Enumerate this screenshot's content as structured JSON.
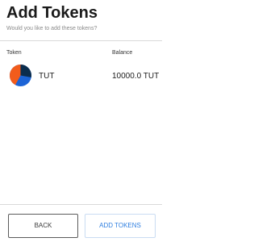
{
  "header": {
    "title": "Add Tokens",
    "subtitle": "Would you like to add these tokens?"
  },
  "table": {
    "columns": [
      "Token",
      "Balance"
    ],
    "rows": [
      {
        "symbol": "TUT",
        "balance": "10000.0 TUT",
        "icon": "token-identicon",
        "colors": [
          "#1c64d6",
          "#f25c1c",
          "#0b2d4d"
        ]
      }
    ]
  },
  "footer": {
    "back_label": "BACK",
    "add_label": "ADD TOKENS"
  },
  "colors": {
    "accent": "#2f7fe0",
    "divider": "#d9d9d9",
    "subtitle": "#8a8a8a"
  }
}
